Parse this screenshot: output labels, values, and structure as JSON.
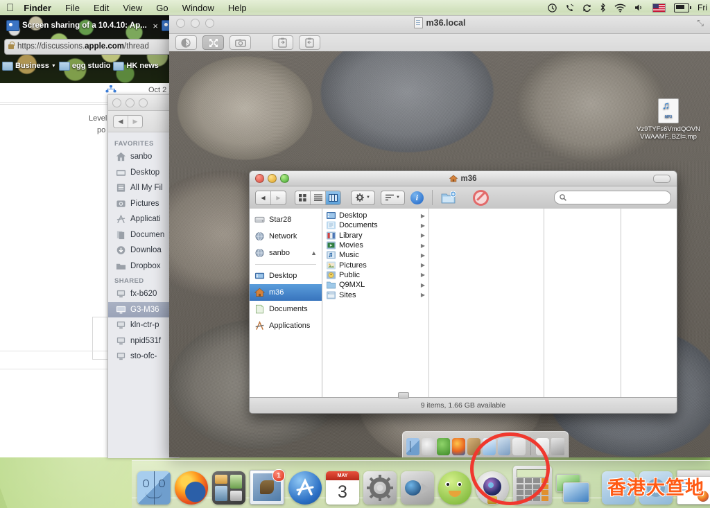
{
  "menubar": {
    "apple": "&#63743;",
    "items": [
      "Finder",
      "File",
      "Edit",
      "View",
      "Go",
      "Window",
      "Help"
    ],
    "status_icons": [
      "timemachine-icon",
      "phone-icon",
      "sync-icon",
      "bluetooth-icon",
      "wifi-icon",
      "volume-icon",
      "us-flag-icon",
      "battery-icon"
    ],
    "clock": "Fri"
  },
  "browser": {
    "tab_title": "Screen sharing of a 10.4.10: Ap...",
    "tab_close": "×",
    "url_prefix": "https://discussions.",
    "url_domain": "apple.com",
    "url_suffix": "/thread",
    "bookmarks": [
      "Business",
      "egg studio",
      "HK news"
    ],
    "page_labels": [
      "Level",
      "po",
      "Oct 2"
    ]
  },
  "bg_finder": {
    "sections": [
      {
        "title": "FAVORITES",
        "items": [
          {
            "label": "sanbo",
            "icon": "home-icon"
          },
          {
            "label": "Desktop",
            "icon": "desktop-icon"
          },
          {
            "label": "All My Fil",
            "icon": "allmyfiles-icon"
          },
          {
            "label": "Pictures",
            "icon": "pictures-icon"
          },
          {
            "label": "Applicati",
            "icon": "applications-icon"
          },
          {
            "label": "Documen",
            "icon": "documents-icon"
          },
          {
            "label": "Downloa",
            "icon": "downloads-icon"
          },
          {
            "label": "Dropbox",
            "icon": "folder-icon"
          }
        ]
      },
      {
        "title": "SHARED",
        "items": [
          {
            "label": "fx-b620",
            "icon": "computer-icon",
            "selected": false
          },
          {
            "label": "G3-M36",
            "icon": "display-icon",
            "selected": true
          },
          {
            "label": "kln-ctr-p",
            "icon": "computer-icon",
            "selected": false
          },
          {
            "label": "npid531f",
            "icon": "computer-icon",
            "selected": false
          },
          {
            "label": "sto-ofc-",
            "icon": "computer-icon",
            "selected": false
          }
        ]
      }
    ]
  },
  "screen_sharing": {
    "title": "m36.local",
    "toolbar": [
      {
        "name": "control-mode-button",
        "active": false
      },
      {
        "name": "fullscreen-button",
        "active": true
      },
      {
        "name": "screenshot-button",
        "active": false
      },
      {
        "name": "get-clipboard-button",
        "active": false
      },
      {
        "name": "send-clipboard-button",
        "active": false
      }
    ],
    "fullscreen_glyph": "⤡"
  },
  "desktop_file": {
    "name_line1": "Vz9TYFs6VmdQOVN",
    "name_line2": "VWAAMF..BZI=.mp",
    "icon": "mp3-file-icon"
  },
  "remote_finder": {
    "title": "m36",
    "view_modes": [
      "icon-view",
      "list-view",
      "column-view"
    ],
    "active_view": "column-view",
    "action_menu": "gear-icon",
    "arrange_menu": "arrange-icon",
    "info_button": "i",
    "new_folder": "new-folder-icon",
    "burn_button": "prohibited-icon",
    "search_placeholder": "",
    "sidebar": {
      "devices": [
        {
          "label": "Star28",
          "icon": "harddisk-icon"
        },
        {
          "label": "Network",
          "icon": "network-globe-icon"
        },
        {
          "label": "sanbo",
          "icon": "network-globe-icon",
          "eject": true
        }
      ],
      "places": [
        {
          "label": "Desktop",
          "icon": "desktop-icon",
          "selected": false
        },
        {
          "label": "m36",
          "icon": "home-icon",
          "selected": true
        },
        {
          "label": "Documents",
          "icon": "documents-icon",
          "selected": false
        },
        {
          "label": "Applications",
          "icon": "applications-icon",
          "selected": false
        }
      ]
    },
    "column_items": [
      {
        "label": "Desktop",
        "icon": "desktop-folder-icon",
        "arrow": "▶"
      },
      {
        "label": "Documents",
        "icon": "documents-folder-icon",
        "arrow": "▶"
      },
      {
        "label": "Library",
        "icon": "library-folder-icon",
        "arrow": "▶"
      },
      {
        "label": "Movies",
        "icon": "movies-folder-icon",
        "arrow": "▶"
      },
      {
        "label": "Music",
        "icon": "music-folder-icon",
        "arrow": "▶"
      },
      {
        "label": "Pictures",
        "icon": "pictures-folder-icon",
        "arrow": "▶"
      },
      {
        "label": "Public",
        "icon": "public-folder-icon",
        "arrow": "▶"
      },
      {
        "label": "Q9MXL",
        "icon": "folder-icon",
        "arrow": "▶"
      },
      {
        "label": "Sites",
        "icon": "sites-folder-icon",
        "arrow": "▶"
      }
    ],
    "status": "9 items, 1.66 GB available"
  },
  "remote_dock": {
    "icons": [
      "finder-icon",
      "network-utility-icon",
      "xcode-icon",
      "firefox-icon",
      "utilities-icon",
      "preview-icon",
      "screensharing-icon",
      "blank-icon",
      "system-prefs-icon",
      "trash-icon"
    ]
  },
  "dock": {
    "icons": [
      {
        "name": "finder-icon",
        "badge": null
      },
      {
        "name": "firefox-icon",
        "badge": null
      },
      {
        "name": "dashboard-icon",
        "badge": null
      },
      {
        "name": "mail-icon",
        "badge": "1"
      },
      {
        "name": "app-store-icon",
        "badge": null
      },
      {
        "name": "calendar-icon",
        "badge": "3",
        "month": "MAY"
      },
      {
        "name": "system-preferences-icon",
        "badge": null
      },
      {
        "name": "facetime-icon",
        "badge": null
      },
      {
        "name": "duck-icon",
        "badge": null
      },
      {
        "name": "photo-booth-icon",
        "badge": null
      },
      {
        "name": "calculator-icon",
        "badge": null
      },
      {
        "name": "screen-sharing-icon",
        "badge": null
      },
      {
        "name": "applications-folder-icon",
        "badge": null
      },
      {
        "name": "downloads-folder-icon",
        "badge": null
      },
      {
        "name": "stack-window-icon",
        "badge": null
      },
      {
        "name": "trash-icon",
        "badge": null
      }
    ]
  },
  "annotation": {
    "highlight_shape": "red-circle",
    "highlight_color": "#f0382e",
    "target": "screen-sharing-icon"
  },
  "watermark": {
    "text": "香港大笪地",
    "color": "#ff5a14"
  }
}
